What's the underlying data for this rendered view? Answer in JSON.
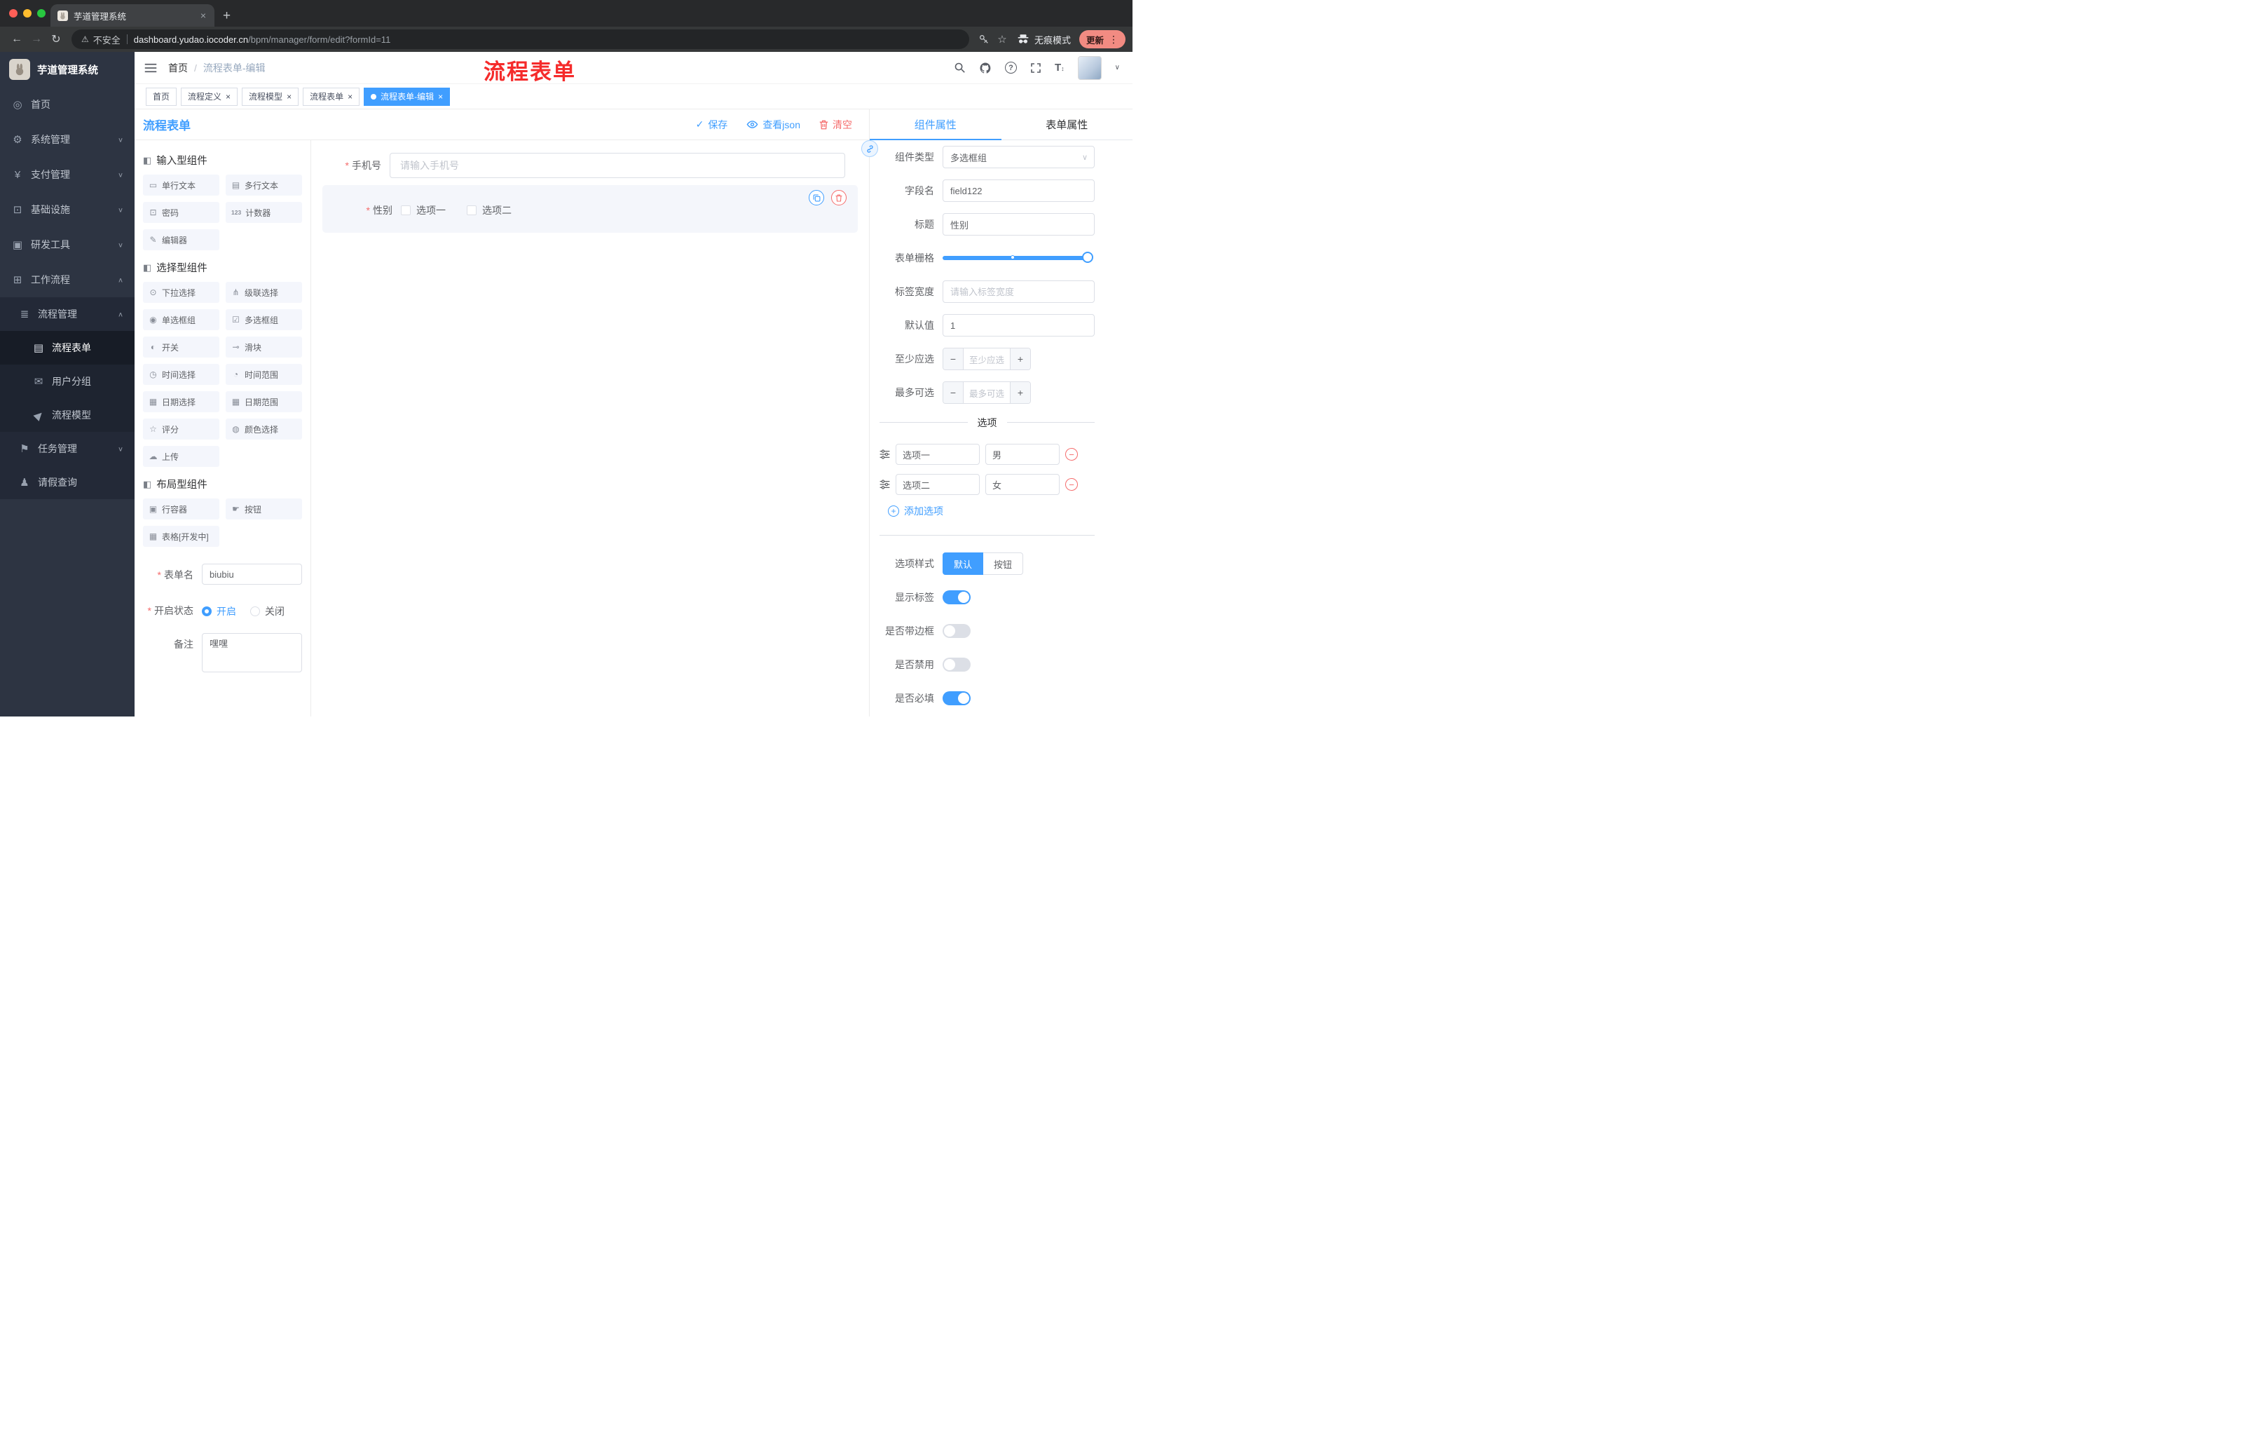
{
  "browser": {
    "tab_title": "芋道管理系统",
    "security": "不安全",
    "host": "dashboard.yudao.iocoder.cn",
    "path": "/bpm/manager/form/edit?formId=11",
    "incognito": "无痕模式",
    "update": "更新"
  },
  "header": {
    "breadcrumb": {
      "home": "首页",
      "current": "流程表单-编辑"
    },
    "annotation": "流程表单"
  },
  "tags": [
    {
      "label": "首页"
    },
    {
      "label": "流程定义"
    },
    {
      "label": "流程模型"
    },
    {
      "label": "流程表单"
    },
    {
      "label": "流程表单-编辑"
    }
  ],
  "sidebar": {
    "title": "芋道管理系统",
    "menu": [
      {
        "label": "首页",
        "icon": "◎"
      },
      {
        "label": "系统管理",
        "icon": "⚙"
      },
      {
        "label": "支付管理",
        "icon": "¥"
      },
      {
        "label": "基础设施",
        "icon": "⊡"
      },
      {
        "label": "研发工具",
        "icon": "▣"
      },
      {
        "label": "工作流程",
        "icon": "⊞"
      },
      {
        "label": "流程管理",
        "icon": "≣"
      },
      {
        "label": "流程表单",
        "icon": "▤"
      },
      {
        "label": "用户分组",
        "icon": "✉"
      },
      {
        "label": "流程模型",
        "icon": "▶"
      },
      {
        "label": "任务管理",
        "icon": "⚑"
      },
      {
        "label": "请假查询",
        "icon": "♟"
      }
    ]
  },
  "designer": {
    "title": "流程表单",
    "actions": {
      "save": "保存",
      "view_json": "查看json",
      "clear": "清空"
    },
    "groups": [
      {
        "title": "输入型组件",
        "items": [
          {
            "label": "单行文本",
            "icon": "▭"
          },
          {
            "label": "多行文本",
            "icon": "▤"
          },
          {
            "label": "密码",
            "icon": "⊡"
          },
          {
            "label": "计数器",
            "icon": "123"
          },
          {
            "label": "编辑器",
            "icon": "✎"
          }
        ]
      },
      {
        "title": "选择型组件",
        "items": [
          {
            "label": "下拉选择",
            "icon": "⊙"
          },
          {
            "label": "级联选择",
            "icon": "⋔"
          },
          {
            "label": "单选框组",
            "icon": "◉"
          },
          {
            "label": "多选框组",
            "icon": "☑"
          },
          {
            "label": "开关",
            "icon": "◐"
          },
          {
            "label": "滑块",
            "icon": "⊸"
          },
          {
            "label": "时间选择",
            "icon": "◷"
          },
          {
            "label": "时间范围",
            "icon": "◔"
          },
          {
            "label": "日期选择",
            "icon": "▦"
          },
          {
            "label": "日期范围",
            "icon": "▦"
          },
          {
            "label": "评分",
            "icon": "☆"
          },
          {
            "label": "颜色选择",
            "icon": "◍"
          },
          {
            "label": "上传",
            "icon": "☁"
          }
        ]
      },
      {
        "title": "布局型组件",
        "items": [
          {
            "label": "行容器",
            "icon": "▣"
          },
          {
            "label": "按钮",
            "icon": "☛"
          },
          {
            "label": "表格[开发中]",
            "icon": "▦"
          }
        ]
      }
    ],
    "meta": {
      "name_label": "表单名",
      "name_value": "biubiu",
      "status_label": "开启状态",
      "status_on": "开启",
      "status_off": "关闭",
      "remark_label": "备注",
      "remark_value": "嘿嘿"
    }
  },
  "canvas": {
    "phone": {
      "label": "手机号",
      "placeholder": "请输入手机号"
    },
    "gender": {
      "label": "性别",
      "option1": "选项一",
      "option2": "选项二"
    }
  },
  "props": {
    "tab_component": "组件属性",
    "tab_form": "表单属性",
    "type_label": "组件类型",
    "type_value": "多选框组",
    "field_label": "字段名",
    "field_value": "field122",
    "title_label": "标题",
    "title_value": "性别",
    "grid_label": "表单栅格",
    "width_label": "标签宽度",
    "width_placeholder": "请输入标签宽度",
    "default_label": "默认值",
    "default_value": "1",
    "min_label": "至少应选",
    "min_placeholder": "至少应选",
    "max_label": "最多可选",
    "max_placeholder": "最多可选",
    "options_title": "选项",
    "options": [
      {
        "label": "选项一",
        "value": "男"
      },
      {
        "label": "选项二",
        "value": "女"
      }
    ],
    "add_option": "添加选项",
    "style_label": "选项样式",
    "style_default": "默认",
    "style_button": "按钮",
    "show_label": "显示标签",
    "border_label": "是否带边框",
    "disabled_label": "是否禁用",
    "required_label": "是否必填"
  },
  "colors": {
    "accent": "#409eff",
    "danger": "#f56c6c",
    "annotation_red": "#f52b2b"
  }
}
